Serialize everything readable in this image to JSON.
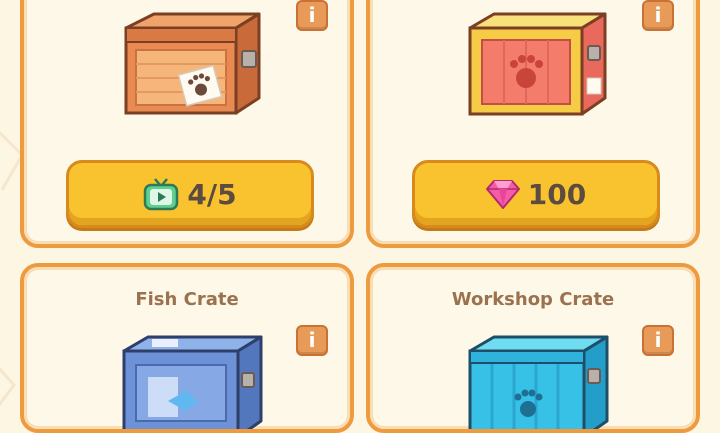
{
  "cards": [
    {
      "title": "",
      "price_value": "4/5",
      "price_icon": "tv-ad-icon",
      "info_label": "i"
    },
    {
      "title": "",
      "price_value": "100",
      "price_icon": "gem-icon",
      "info_label": "i"
    },
    {
      "title": "Fish Crate",
      "info_label": "i"
    },
    {
      "title": "Workshop Crate",
      "info_label": "i"
    }
  ],
  "colors": {
    "background": "#fdf6e3",
    "card_border": "#ee9a3f",
    "button_fill": "#f9c32f",
    "info_button": "#e89a59",
    "title_text": "#9b7250"
  }
}
